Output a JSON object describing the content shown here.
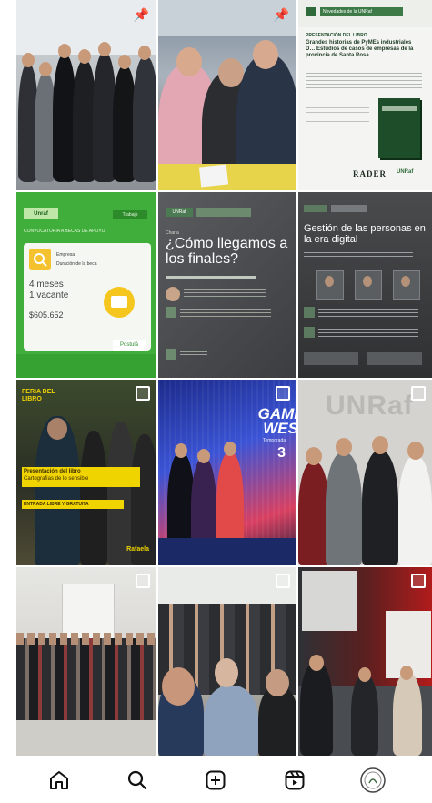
{
  "tiles": {
    "t3": {
      "header": "Novedades de la UNRaf",
      "line1": "PRESENTACIÓN DEL LIBRO",
      "title": "Grandes historias de PyMEs industriales D… Estudios de casos de empresas de la provincia de Santa Rosa",
      "footer1": "RADER",
      "footer2": "UNRaf"
    },
    "t4": {
      "badge": "Unraf",
      "tag": "Trabajo",
      "heading": "CONVOCATORIA A BECAS DE APOYO",
      "item1": "Empresa",
      "item2": "Duración de la beca",
      "duration": "4 meses",
      "vacancies": "1 vacante",
      "amount": "$605.652",
      "button": "Postulá"
    },
    "t5": {
      "header": "UNRaf",
      "kicker": "Charla",
      "title": "¿Cómo llegamos a los finales?",
      "speaker": "Lic. ..."
    },
    "t6": {
      "title": "Gestión de las personas en la era digital",
      "sub": "Personas"
    },
    "t7": {
      "badge": "FERIA DEL LIBRO",
      "banner1": "Presentación del libro",
      "banner2": "Cartografías de lo sensible",
      "banner3": "ENTRADA LIBRE Y GRATUITA",
      "logo": "Rafaela"
    },
    "t8": {
      "title": "GAMI WES",
      "sub": "Temporada",
      "num": "3"
    },
    "t9": {
      "wall": "UNRaf"
    }
  },
  "nav": {
    "items": [
      "home",
      "search",
      "create",
      "reels",
      "profile"
    ]
  },
  "colors": {
    "green": "#3fae3a",
    "dark": "#3a3a3a",
    "accent": "#f0d400"
  }
}
